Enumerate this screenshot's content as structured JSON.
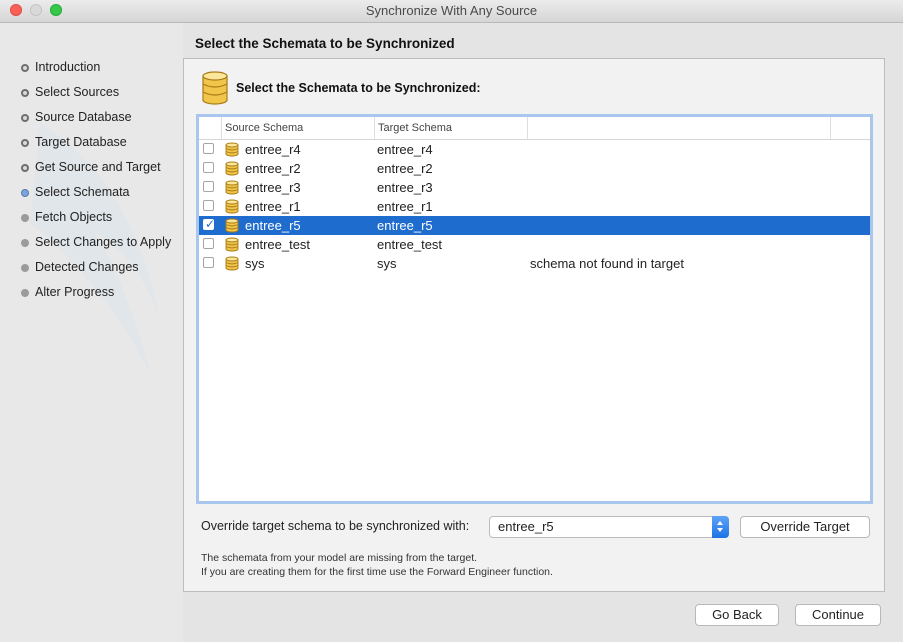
{
  "window": {
    "title": "Synchronize With Any Source"
  },
  "sidebar": {
    "steps": [
      {
        "label": "Introduction",
        "state": "done"
      },
      {
        "label": "Select Sources",
        "state": "done"
      },
      {
        "label": "Source Database",
        "state": "done"
      },
      {
        "label": "Target Database",
        "state": "done"
      },
      {
        "label": "Get Source and Target",
        "state": "done"
      },
      {
        "label": "Select Schemata",
        "state": "current"
      },
      {
        "label": "Fetch Objects",
        "state": "pending"
      },
      {
        "label": "Select Changes to Apply",
        "state": "pending"
      },
      {
        "label": "Detected Changes",
        "state": "pending"
      },
      {
        "label": "Alter Progress",
        "state": "pending"
      }
    ]
  },
  "page": {
    "heading": "Select the Schemata to be Synchronized"
  },
  "panel": {
    "title": "Select the Schemata to be Synchronized:",
    "table": {
      "headers": {
        "source": "Source Schema",
        "target": "Target Schema"
      },
      "rows": [
        {
          "checked": false,
          "selected": false,
          "source": "entree_r4",
          "target": "entree_r4",
          "note": ""
        },
        {
          "checked": false,
          "selected": false,
          "source": "entree_r2",
          "target": "entree_r2",
          "note": ""
        },
        {
          "checked": false,
          "selected": false,
          "source": "entree_r3",
          "target": "entree_r3",
          "note": ""
        },
        {
          "checked": false,
          "selected": false,
          "source": "entree_r1",
          "target": "entree_r1",
          "note": ""
        },
        {
          "checked": true,
          "selected": true,
          "source": "entree_r5",
          "target": "entree_r5",
          "note": ""
        },
        {
          "checked": false,
          "selected": false,
          "source": "entree_test",
          "target": "entree_test",
          "note": ""
        },
        {
          "checked": false,
          "selected": false,
          "source": "sys",
          "target": "sys",
          "note": "schema not found in target"
        }
      ]
    },
    "override": {
      "label": "Override target schema to be synchronized with:",
      "selected_value": "entree_r5",
      "button_label": "Override Target"
    },
    "notes": [
      "The schemata from your model are missing from the target.",
      "If you are creating them for the first time use the Forward Engineer function."
    ]
  },
  "footer": {
    "back_label": "Go Back",
    "continue_label": "Continue"
  },
  "colors": {
    "selection": "#1f6ccf",
    "current_step": "#7aa4dd",
    "table_focus_ring": "#a9c6ee"
  },
  "icons": {
    "schema": "database-icon"
  }
}
